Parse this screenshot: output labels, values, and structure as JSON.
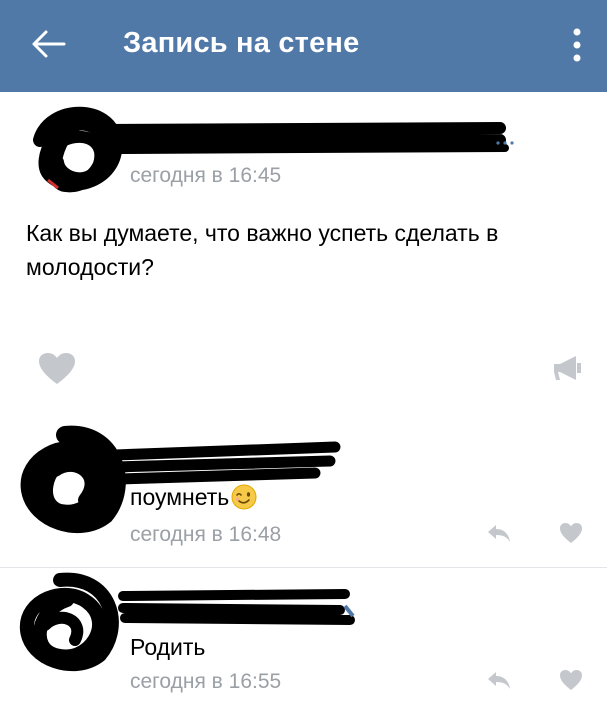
{
  "header": {
    "title": "Запись на стене",
    "back_icon": "arrow-left-icon",
    "menu_icon": "more-vertical-icon",
    "background": "#5079a8"
  },
  "post": {
    "time": "сегодня в 16:45",
    "text": "Как вы думаете, что важно успеть сделать в молодости?",
    "like_icon": "heart-icon",
    "share_icon": "megaphone-icon"
  },
  "comments": [
    {
      "text": "поумнеть",
      "emoji": "winking-face",
      "time": "сегодня в 16:48",
      "reply_icon": "reply-arrow-icon",
      "like_icon": "heart-icon"
    },
    {
      "text": "Родить",
      "time": "сегодня в 16:55",
      "reply_icon": "reply-arrow-icon",
      "like_icon": "heart-icon"
    }
  ],
  "colors": {
    "secondary_text": "#9aa0a6",
    "icon_gray": "#c4c8cd"
  }
}
